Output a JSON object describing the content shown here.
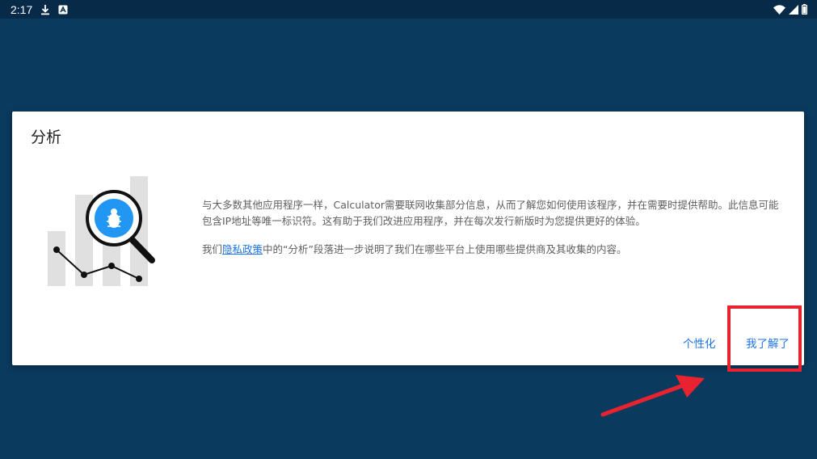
{
  "status_bar": {
    "time": "2:17",
    "icons": [
      "download-icon",
      "app-notification-icon",
      "wifi-icon",
      "cell-signal-icon",
      "battery-icon"
    ]
  },
  "dialog": {
    "title": "分析",
    "body": {
      "paragraph1": "与大多数其他应用程序一样，Calculator需要联网收集部分信息，从而了解您如何使用该程序，并在需要时提供帮助。此信息可能包含IP地址等唯一标识符。这有助于我们改进应用程序，并在每次发行新版时为您提供更好的体验。",
      "p2_prefix": "我们",
      "p2_link": "隐私政策",
      "p2_suffix": "中的“分析”段落进一步说明了我们在哪些平台上使用哪些提供商及其收集的内容。"
    },
    "buttons": {
      "personalize": "个性化",
      "ok": "我了解了"
    }
  },
  "colors": {
    "background": "#0a3a5e",
    "status_bar": "#062a47",
    "accent": "#1a73e8",
    "annotation": "#e8232f",
    "illustration_blue": "#2196f3"
  }
}
